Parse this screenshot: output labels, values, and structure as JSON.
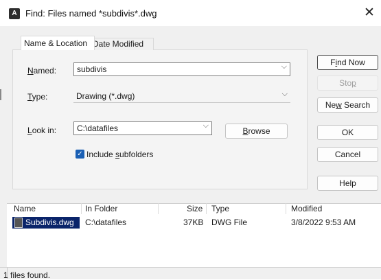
{
  "window": {
    "title": "Find: Files named *subdivis*.dwg",
    "close_glyph": "✕"
  },
  "tabs": [
    {
      "label": "Name & Location",
      "active": true
    },
    {
      "label": "Date Modified",
      "active": false
    }
  ],
  "form": {
    "named": {
      "label_mn": "N",
      "label_rest": "amed:",
      "value": "subdivis"
    },
    "type": {
      "label_mn": "T",
      "label_rest": "ype:",
      "value": "Drawing (*.dwg)"
    },
    "lookin": {
      "label_mn": "L",
      "label_rest": "ook in:",
      "value": "C:\\datafiles"
    },
    "browse": {
      "mn": "B",
      "rest": "rowse"
    },
    "include": {
      "pre": "Include ",
      "mn": "s",
      "rest": "ubfolders",
      "checked": true
    }
  },
  "buttons": {
    "find_now": {
      "pre": "F",
      "mn": "i",
      "rest": "nd Now"
    },
    "stop": {
      "pre": "Sto",
      "mn": "p",
      "rest": ""
    },
    "new_search": {
      "pre": "Ne",
      "mn": "w",
      "rest": " Search"
    },
    "ok": "OK",
    "cancel": "Cancel",
    "help": "Help"
  },
  "results": {
    "columns": [
      "Name",
      "In Folder",
      "Size",
      "Type",
      "Modified"
    ],
    "rows": [
      {
        "name": "Subdivis.dwg",
        "folder": "C:\\datafiles",
        "size": "37KB",
        "type": "DWG File",
        "modified": "3/8/2022 9:53 AM"
      }
    ]
  },
  "status": "1 files found.",
  "icons": {
    "app": "autocad-app-icon",
    "chevron": "⌵",
    "check": "✓"
  },
  "colors": {
    "selection": "#0a246a",
    "checkbox": "#1a5fb4"
  }
}
